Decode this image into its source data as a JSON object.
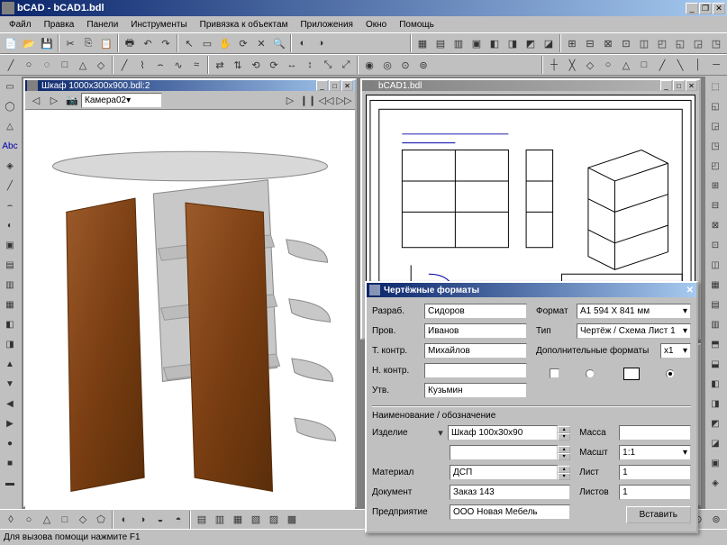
{
  "app": {
    "title": "bCAD - bCAD1.bdl",
    "icon": "app-icon"
  },
  "menus": [
    "Файл",
    "Правка",
    "Панели",
    "Инструменты",
    "Привязка к объектам",
    "Приложения",
    "Окно",
    "Помощь"
  ],
  "doc1": {
    "title": "Шкаф 1000x300x900.bdl:2",
    "camera": "Камера02"
  },
  "doc2": {
    "title": "bCAD1.bdl"
  },
  "dialog": {
    "title": "Чертёжные форматы",
    "left": {
      "razrab_label": "Разраб.",
      "razrab": "Сидоров",
      "prov_label": "Пров.",
      "prov": "Иванов",
      "tkontr_label": "Т. контр.",
      "tkontr": "Михайлов",
      "nkontr_label": "Н. контр.",
      "nkontr": "",
      "utv_label": "Утв.",
      "utv": "Кузьмин"
    },
    "right": {
      "format_label": "Формат",
      "format": "А1 594 Х 841 мм",
      "type_label": "Тип",
      "type": "Чертёж / Схема Лист 1",
      "extra_label": "Дополнительные форматы",
      "extra": "x1"
    },
    "naming_label": "Наименование / обозначение",
    "bottom": {
      "izdelie_label": "Изделие",
      "izdelie": "Шкаф 100х30х90",
      "material_label": "Материал",
      "material": "ДСП",
      "document_label": "Документ",
      "document": "Заказ 143",
      "predpr_label": "Предприятие",
      "predpr": "ООО Новая Мебель",
      "massa_label": "Масса",
      "massa": "",
      "masht_label": "Масшт",
      "masht": "1:1",
      "list_label": "Лист",
      "list": "1",
      "listov_label": "Листов",
      "listov": "1"
    },
    "insert_btn": "Вставить"
  },
  "statusbar": {
    "text": "Для вызова помощи нажмите F1"
  }
}
